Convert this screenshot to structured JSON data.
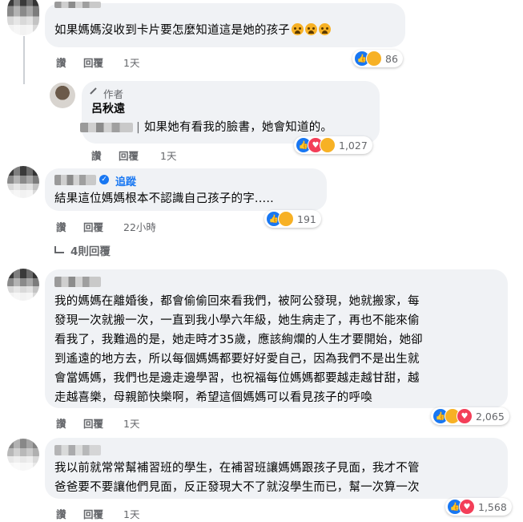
{
  "comments": [
    {
      "text": [
        "如果媽媽沒收到卡片要怎麼知道這是她的孩子"
      ],
      "actions": {
        "like": "讚",
        "reply": "回覆",
        "time": "1天"
      },
      "reactions": {
        "count": "86",
        "icons": [
          "like",
          "sad"
        ]
      }
    },
    {
      "badge": "作者",
      "author": "呂秋遠",
      "text": [
        "如果她有看我的臉書，她會知道的。"
      ],
      "actions": {
        "like": "讚",
        "reply": "回覆",
        "time": "1天"
      },
      "reactions": {
        "count": "1,027",
        "icons": [
          "like",
          "love",
          "care"
        ]
      }
    },
    {
      "follow": "追蹤",
      "text": [
        "結果這位媽媽根本不認識自己孩子的字....."
      ],
      "actions": {
        "like": "讚",
        "reply": "回覆",
        "time": "22小時"
      },
      "reactions": {
        "count": "191",
        "icons": [
          "like",
          "sad"
        ]
      }
    },
    {
      "text": [
        "我的媽媽在離婚後，都會偷偷回來看我們，被阿公發現，她就搬家，每",
        "發現一次就搬一次，一直到我小學六年級，她生病走了，再也不能來偷",
        "看我了，我難過的是，她走時才35歲，應該絢爛的人生才要開始，她卻",
        "到遙遠的地方去，所以每個媽媽都要好好愛自己，因為我們不是出生就",
        "會當媽媽，我們也是邊走邊學習，也祝福每位媽媽都要越走越甘甜，越",
        "走越喜樂，母親節快樂啊，希望這個媽媽可以看見孩子的呼喚"
      ],
      "actions": {
        "like": "讚",
        "reply": "回覆",
        "time": "1天"
      },
      "reactions": {
        "count": "2,065",
        "icons": [
          "like",
          "care",
          "love"
        ]
      }
    },
    {
      "text": [
        "我以前就常常幫補習班的學生，在補習班讓媽媽跟孩子見面，我才不管",
        "爸爸要不要讓他們見面，反正發現大不了就沒學生而已，幫一次算一次"
      ],
      "actions": {
        "like": "讚",
        "reply": "回覆",
        "time": "1天"
      },
      "reactions": {
        "count": "1,568",
        "icons": [
          "like",
          "love"
        ]
      }
    }
  ],
  "replies_toggle": "4則回覆",
  "colors": {
    "link": "#1877f2",
    "bubble": "#f0f2f5",
    "meta": "#65676b"
  }
}
